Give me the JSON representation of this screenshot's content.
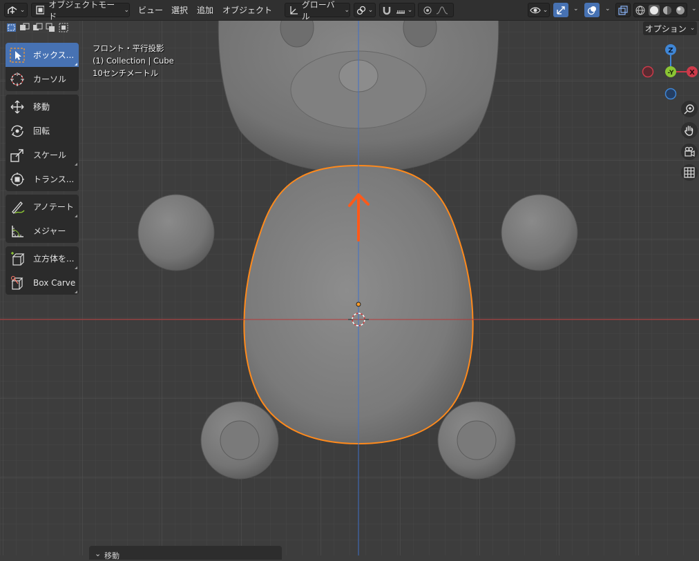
{
  "header": {
    "editor_type_icon": "viewport-3d-icon",
    "mode_label": "オブジェクトモード",
    "menus": [
      "ビュー",
      "選択",
      "追加",
      "オブジェクト"
    ],
    "transform_orientation": "グローバル"
  },
  "overlay_info": {
    "view_name": "フロント・平行投影",
    "collection": "(1) Collection | Cube",
    "scale": "10センチメートル"
  },
  "options_label": "オプション",
  "gizmo": {
    "z": "Z",
    "y": "-Y",
    "x": "X"
  },
  "toolbar": {
    "select_box": "ボックス...",
    "cursor": "カーソル",
    "move": "移動",
    "rotate": "回転",
    "scale": "スケール",
    "transform": "トランス...",
    "annotate": "アノテート",
    "measure": "メジャー",
    "add_cube": "立方体を...",
    "box_carve": "Box Carve"
  },
  "last_operator": "移動",
  "colors": {
    "selection_outline": "#ff8a1c",
    "active_tool": "#4772b3",
    "x_axis": "#cc3a4a",
    "y_axis": "#8bc534",
    "z_axis": "#3f86d6"
  }
}
